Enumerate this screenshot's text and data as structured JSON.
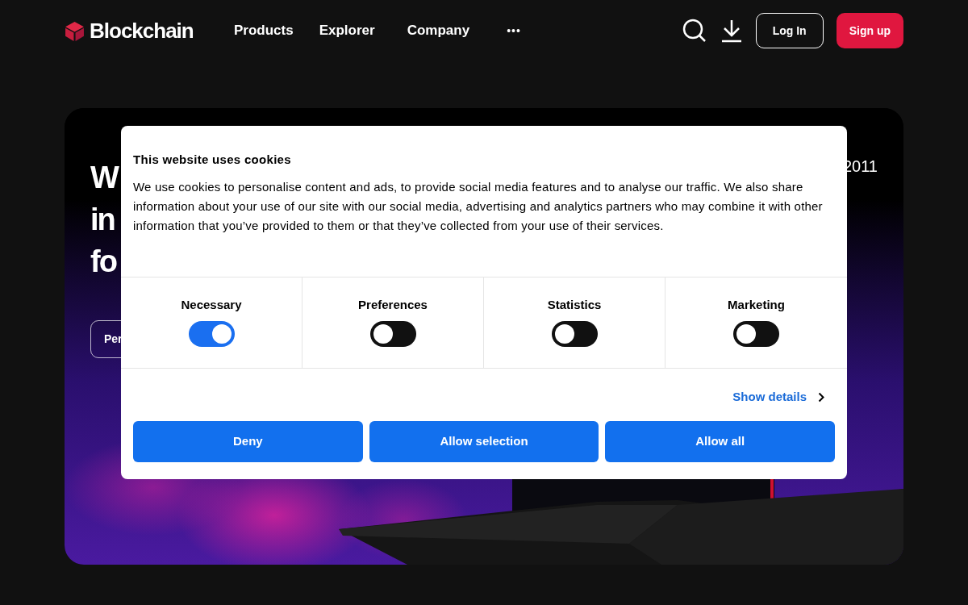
{
  "nav": {
    "brand": "Blockchain",
    "links": [
      "Products",
      "Explorer",
      "Company"
    ],
    "more": "•••",
    "log_in": "Log In",
    "sign_up": "Sign up"
  },
  "hero": {
    "heading_lines": [
      "W",
      "in",
      "fo"
    ],
    "button": "Per",
    "year": "2011",
    "background": {
      "kind": "picture"
    }
  },
  "cookie_dialog": {
    "title": "This website uses cookies",
    "body": "We use cookies to personalise content and ads, to provide social media features and to analyse our traffic. We also share information about your use of our site with our social media, advertising and analytics partners who may combine it with other information that you’ve provided to them or that they’ve collected from your use of their services.",
    "categories": [
      {
        "label": "Necessary",
        "on": true
      },
      {
        "label": "Preferences",
        "on": false
      },
      {
        "label": "Statistics",
        "on": false
      },
      {
        "label": "Marketing",
        "on": false
      }
    ],
    "details_link": "Show details",
    "buttons": [
      "Deny",
      "Allow selection",
      "Allow all"
    ]
  }
}
